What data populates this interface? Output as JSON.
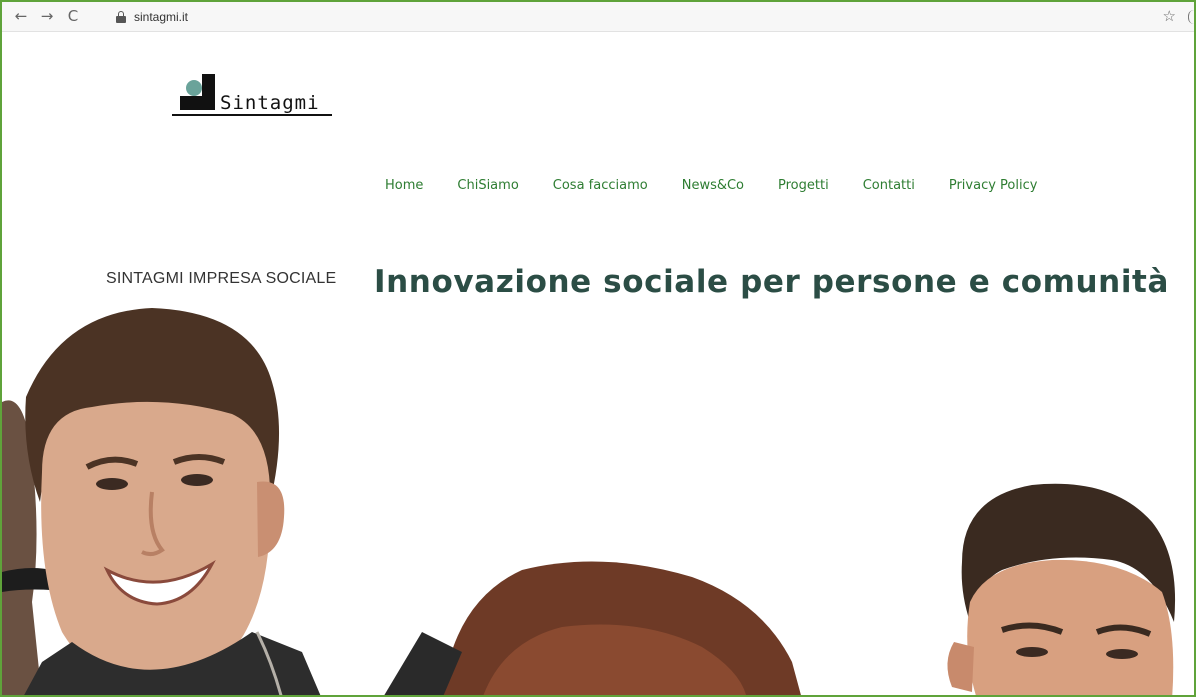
{
  "browser": {
    "url": "sintagmi.it",
    "icons": {
      "back": "arrow-left-icon",
      "forward": "arrow-right-icon",
      "reload": "reload-icon",
      "secure": "lock-icon",
      "bookmark": "star-icon"
    }
  },
  "site": {
    "logo_text": "Sintagmi",
    "menu": [
      {
        "label": "Home"
      },
      {
        "label": "ChiSiamo"
      },
      {
        "label": "Cosa facciamo"
      },
      {
        "label": "News&Co"
      },
      {
        "label": "Progetti"
      },
      {
        "label": "Contatti"
      },
      {
        "label": "Privacy Policy"
      }
    ],
    "tagline": "SINTAGMI IMPRESA SOCIALE",
    "headline": "Innovazione sociale per persone e comunità"
  },
  "colors": {
    "frame_border": "#5fa33a",
    "menu_text": "#2e7d32",
    "headline_text": "#2b4d45",
    "logo_dot": "#6aa39a"
  }
}
